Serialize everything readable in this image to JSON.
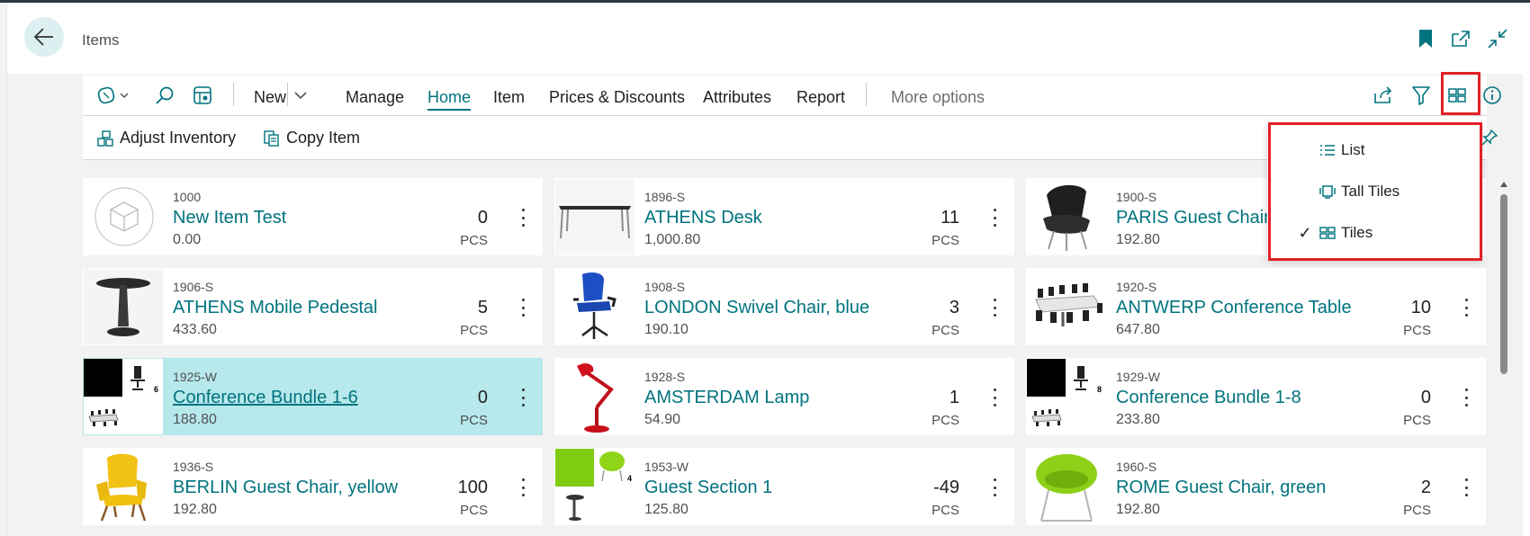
{
  "page": {
    "title": "Items"
  },
  "actionbar": {
    "new_label": "New",
    "manage_label": "Manage",
    "home_label": "Home",
    "item_label": "Item",
    "prices_label": "Prices & Discounts",
    "attributes_label": "Attributes",
    "report_label": "Report",
    "more_label": "More options"
  },
  "subbar": {
    "adjust_label": "Adjust Inventory",
    "copy_label": "Copy Item"
  },
  "view_menu": {
    "items": [
      {
        "label": "List",
        "checked": false,
        "icon": "list-icon"
      },
      {
        "label": "Tall Tiles",
        "checked": false,
        "icon": "tall-tiles-icon"
      },
      {
        "label": "Tiles",
        "checked": true,
        "icon": "tiles-icon"
      }
    ],
    "check_mark": "✓"
  },
  "tiles": [
    {
      "code": "1000",
      "name": "New Item Test",
      "price": "0.00",
      "qty": "0",
      "unit": "PCS",
      "image": "placeholder-box"
    },
    {
      "code": "1896-S",
      "name": "ATHENS Desk",
      "price": "1,000.80",
      "qty": "11",
      "unit": "PCS",
      "image": "desk"
    },
    {
      "code": "1900-S",
      "name": "PARIS Guest Chair, black",
      "price": "192.80",
      "qty": "",
      "unit": "",
      "image": "black-lounge-chair"
    },
    {
      "code": "1906-S",
      "name": "ATHENS Mobile Pedestal",
      "price": "433.60",
      "qty": "5",
      "unit": "PCS",
      "image": "pedestal"
    },
    {
      "code": "1908-S",
      "name": "LONDON Swivel Chair, blue",
      "price": "190.10",
      "qty": "3",
      "unit": "PCS",
      "image": "blue-swivel-chair"
    },
    {
      "code": "1920-S",
      "name": "ANTWERP Conference Table",
      "price": "647.80",
      "qty": "10",
      "unit": "PCS",
      "image": "conference-table"
    },
    {
      "code": "1925-W",
      "name": "Conference Bundle 1-6",
      "price": "188.80",
      "qty": "0",
      "unit": "PCS",
      "image": "bundle-6"
    },
    {
      "code": "1928-S",
      "name": "AMSTERDAM Lamp",
      "price": "54.90",
      "qty": "1",
      "unit": "PCS",
      "image": "red-lamp"
    },
    {
      "code": "1929-W",
      "name": "Conference Bundle 1-8",
      "price": "233.80",
      "qty": "0",
      "unit": "PCS",
      "image": "bundle-8"
    },
    {
      "code": "1936-S",
      "name": "BERLIN Guest Chair, yellow",
      "price": "192.80",
      "qty": "100",
      "unit": "PCS",
      "image": "yellow-chair"
    },
    {
      "code": "1953-W",
      "name": "Guest Section 1",
      "price": "125.80",
      "qty": "-49",
      "unit": "PCS",
      "image": "guest-section"
    },
    {
      "code": "1960-S",
      "name": "ROME Guest Chair, green",
      "price": "192.80",
      "qty": "2",
      "unit": "PCS",
      "image": "green-chair"
    }
  ],
  "bundle_badges": {
    "bundle6": "6",
    "bundle8": "8",
    "guest": "4"
  },
  "colors": {
    "accent": "#00737e",
    "selected": "#b6e8ec",
    "highlight": "#e32027"
  }
}
